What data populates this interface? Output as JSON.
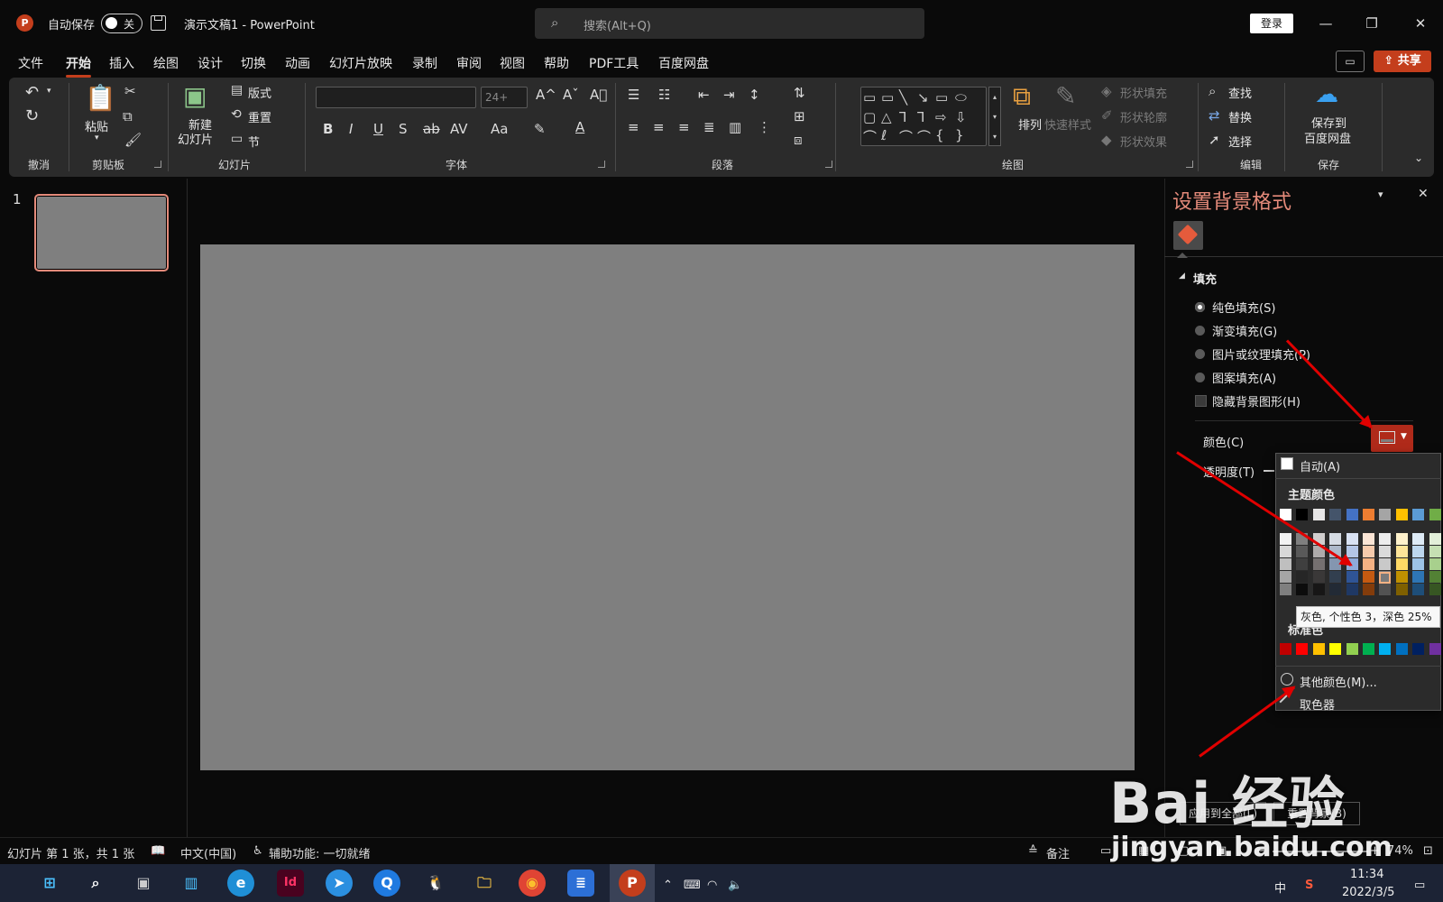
{
  "titlebar": {
    "autosave_label": "自动保存",
    "toggle_state": "关",
    "doc_title": "演示文稿1  -  PowerPoint",
    "search_placeholder": "搜索(Alt+Q)",
    "login": "登录",
    "minimize": "—",
    "restore": "❐",
    "close": "✕"
  },
  "tabs": [
    "文件",
    "开始",
    "插入",
    "绘图",
    "设计",
    "切换",
    "动画",
    "幻灯片放映",
    "录制",
    "审阅",
    "视图",
    "帮助",
    "PDF工具",
    "百度网盘"
  ],
  "share_label": "共享",
  "ribbon": {
    "groups": {
      "undo": "撤消",
      "clipboard": "剪贴板",
      "slides": "幻灯片",
      "font": "字体",
      "paragraph": "段落",
      "drawing": "绘图",
      "editing": "编辑",
      "save": "保存"
    },
    "paste": "粘贴",
    "new_slide_1": "新建",
    "new_slide_2": "幻灯片",
    "layout": "版式",
    "reset": "重置",
    "section": "节",
    "font_size": "24+",
    "arrange": "排列",
    "quick_styles": "快速样式",
    "shape_fill": "形状填充",
    "shape_outline": "形状轮廓",
    "shape_effects": "形状效果",
    "find": "查找",
    "replace": "替换",
    "select": "选择",
    "save_to_1": "保存到",
    "save_to_2": "百度网盘"
  },
  "slides_pane": {
    "slide_number": "1"
  },
  "format_pane": {
    "title": "设置背景格式",
    "fill_header": "填充",
    "options": [
      "纯色填充(S)",
      "渐变填充(G)",
      "图片或纹理填充(P)",
      "图案填充(A)"
    ],
    "hide_bg": "隐藏背景图形(H)",
    "color_label": "颜色(C)",
    "transparency_label": "透明度(T)",
    "apply_all": "应用到全部(L)",
    "reset_bg": "重置背景(B)"
  },
  "color_dropdown": {
    "auto": "自动(A)",
    "theme_colors": "主题颜色",
    "tooltip": "灰色, 个性色 3，深色 25%",
    "standard_colors": "标准色",
    "more_colors": "其他颜色(M)...",
    "eyedropper": "取色器",
    "theme_top": [
      "#ffffff",
      "#000000",
      "#e7e6e6",
      "#44546a",
      "#4472c4",
      "#ed7d31",
      "#a5a5a5",
      "#ffc000",
      "#5b9bd5",
      "#70ad47"
    ],
    "theme_shades": [
      [
        "#f2f2f2",
        "#7f7f7f",
        "#d0cece",
        "#d6dce4",
        "#d9e2f3",
        "#fbe5d5",
        "#ededed",
        "#fff2cc",
        "#deebf6",
        "#e2efd9"
      ],
      [
        "#d8d8d8",
        "#595959",
        "#aeabab",
        "#adb9ca",
        "#b4c6e7",
        "#f7cbac",
        "#dbdbdb",
        "#fee599",
        "#bdd7ee",
        "#c5e0b3"
      ],
      [
        "#bfbfbf",
        "#3f3f3f",
        "#757070",
        "#8496b0",
        "#8eaadb",
        "#f4b183",
        "#c9c9c9",
        "#ffd965",
        "#9dc3e6",
        "#a8d08d"
      ],
      [
        "#a5a5a5",
        "#262626",
        "#3a3838",
        "#323f4f",
        "#2f5496",
        "#c55a11",
        "#7b7b7b",
        "#bf9000",
        "#2e75b5",
        "#538135"
      ],
      [
        "#7f7f7f",
        "#0c0c0c",
        "#171616",
        "#222a35",
        "#1f3864",
        "#833c0b",
        "#525252",
        "#7f6000",
        "#1e4e79",
        "#375623"
      ]
    ],
    "standard": [
      "#c00000",
      "#ff0000",
      "#ffc000",
      "#ffff00",
      "#92d050",
      "#00b050",
      "#00b0f0",
      "#0070c0",
      "#002060",
      "#7030a0"
    ]
  },
  "statusbar": {
    "slide_info": "幻灯片 第 1 张，共 1 张",
    "language": "中文(中国)",
    "accessibility": "辅助功能: 一切就绪",
    "notes": "备注",
    "zoom": "74%"
  },
  "watermark": {
    "brand": "Bai 经验",
    "url": "jingyan.baidu.com"
  },
  "taskbar": {
    "ime": "中",
    "time": "11:34",
    "date": "2022/3/5"
  }
}
